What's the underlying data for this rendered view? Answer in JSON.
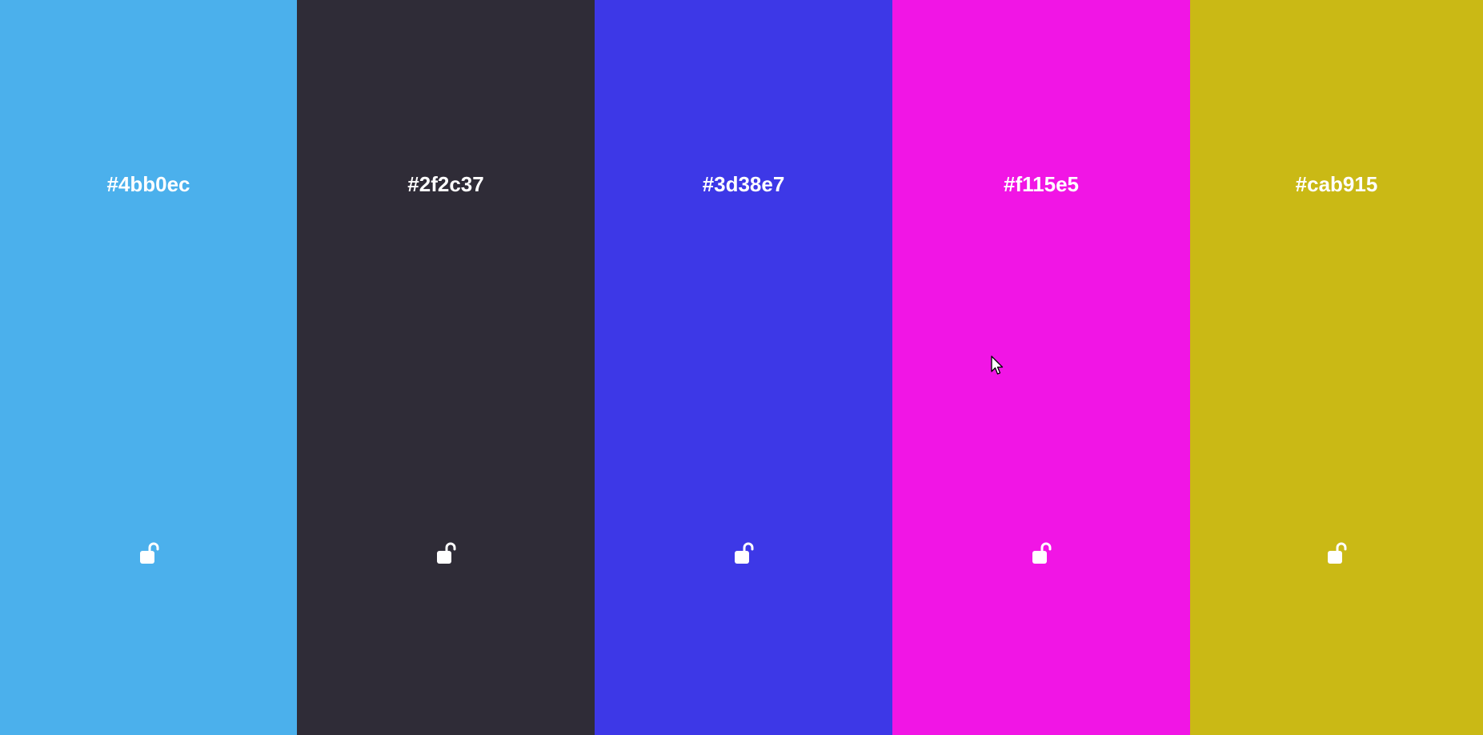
{
  "palette": {
    "columns": [
      {
        "hex": "#4bb0ec",
        "color": "#4bb0ec",
        "lock_icon": "unlocked-padlock-icon",
        "locked": false
      },
      {
        "hex": "#2f2c37",
        "color": "#2f2c37",
        "lock_icon": "unlocked-padlock-icon",
        "locked": false
      },
      {
        "hex": "#3d38e7",
        "color": "#3d38e7",
        "lock_icon": "unlocked-padlock-icon",
        "locked": false
      },
      {
        "hex": "#f115e5",
        "color": "#f115e5",
        "lock_icon": "unlocked-padlock-icon",
        "locked": false
      },
      {
        "hex": "#cab915",
        "color": "#cab915",
        "lock_icon": "unlocked-padlock-icon",
        "locked": false
      }
    ]
  },
  "colors": {
    "text": "#ffffff",
    "icon": "#ffffff"
  }
}
